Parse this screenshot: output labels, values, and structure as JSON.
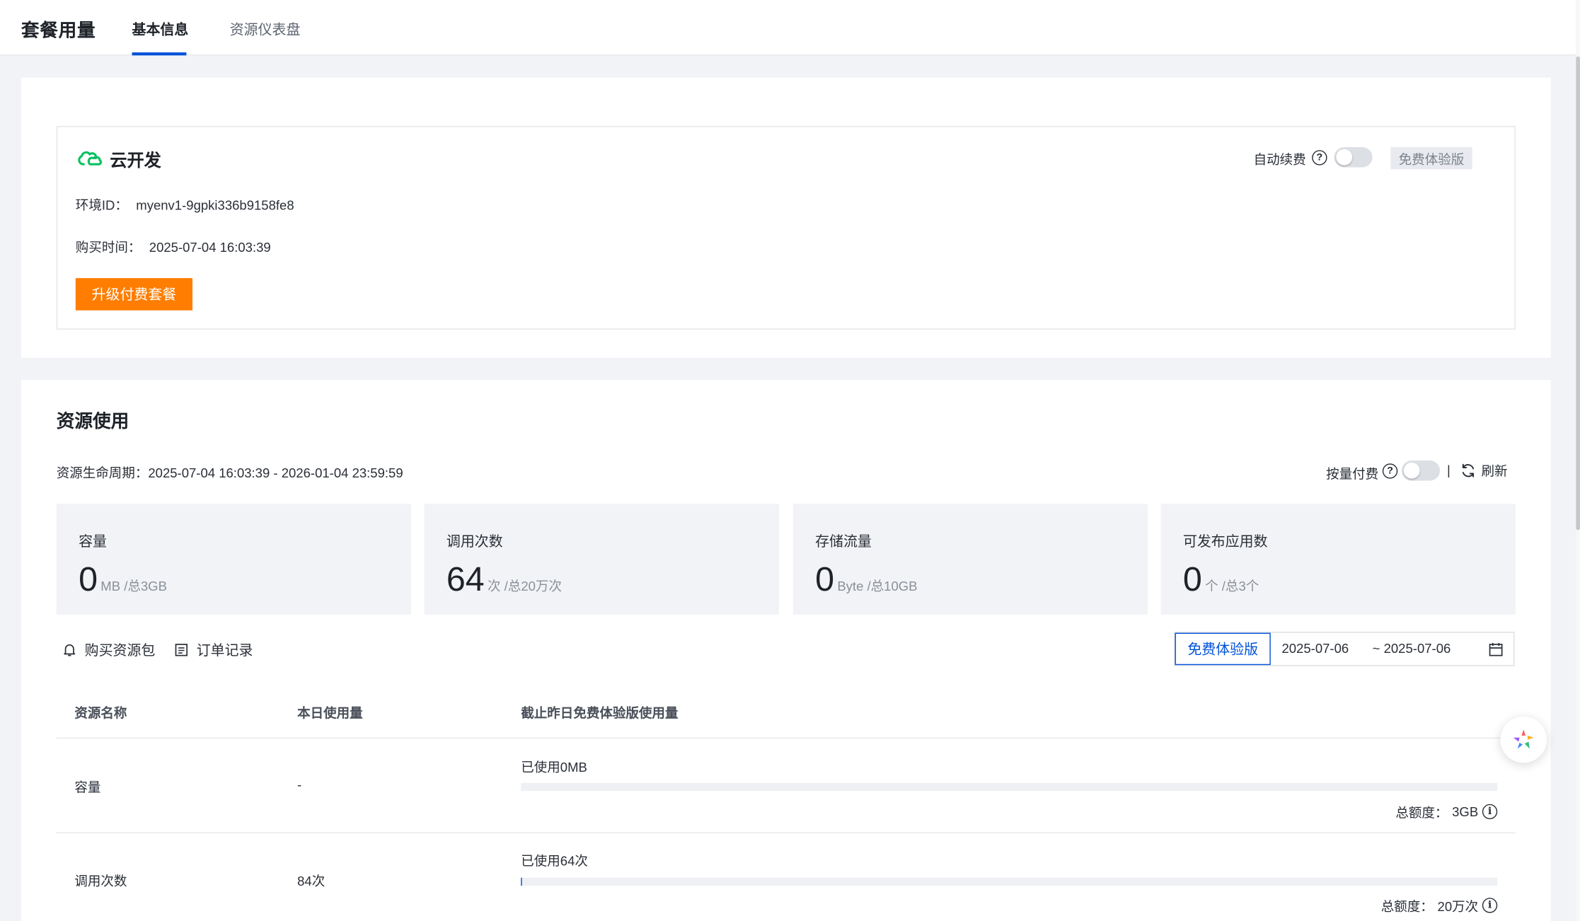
{
  "header": {
    "title": "套餐用量",
    "tabs": [
      {
        "label": "基本信息",
        "active": true
      },
      {
        "label": "资源仪表盘",
        "active": false
      }
    ]
  },
  "env": {
    "product": "云开发",
    "env_id_label": "环境ID：",
    "env_id": "myenv1-9gpki336b9158fe8",
    "purchase_time_label": "购买时间：",
    "purchase_time": "2025-07-04 16:03:39",
    "upgrade_button": "升级付费套餐",
    "auto_renew_label": "自动续费",
    "auto_renew_on": false,
    "edition_tag": "免费体验版"
  },
  "resource": {
    "title": "资源使用",
    "lifecycle_label": "资源生命周期：",
    "lifecycle": "2025-07-04 16:03:39 - 2026-01-04 23:59:59",
    "pay_by_usage_label": "按量付费",
    "pay_by_usage_on": false,
    "separator": "|",
    "refresh_label": "刷新",
    "stats": [
      {
        "label": "容量",
        "value": "0",
        "unit": "MB /总3GB"
      },
      {
        "label": "调用次数",
        "value": "64",
        "unit": "次 /总20万次"
      },
      {
        "label": "存储流量",
        "value": "0",
        "unit": "Byte /总10GB"
      },
      {
        "label": "可发布应用数",
        "value": "0",
        "unit": "个 /总3个"
      }
    ],
    "buy_pack_label": "购买资源包",
    "orders_label": "订单记录",
    "edition_filter": "免费体验版",
    "date_start": "2025-07-06",
    "date_end": "~ 2025-07-06",
    "table": {
      "headers": [
        "资源名称",
        "本日使用量",
        "截止昨日免费体验版使用量"
      ],
      "rows": [
        {
          "name": "容量",
          "today": "-",
          "used": "已使用0MB",
          "used_fraction": 0,
          "total_label": "总额度：",
          "total": "3GB"
        },
        {
          "name": "调用次数",
          "today": "84次",
          "used": "已使用64次",
          "used_fraction": 0.00032,
          "total_label": "总额度：",
          "total": "20万次"
        }
      ]
    }
  },
  "colors": {
    "accent": "#0052d9",
    "upgrade": "#ff7d00",
    "logo_green": "#07c160"
  },
  "icons": {
    "info": "i",
    "question": "?"
  }
}
